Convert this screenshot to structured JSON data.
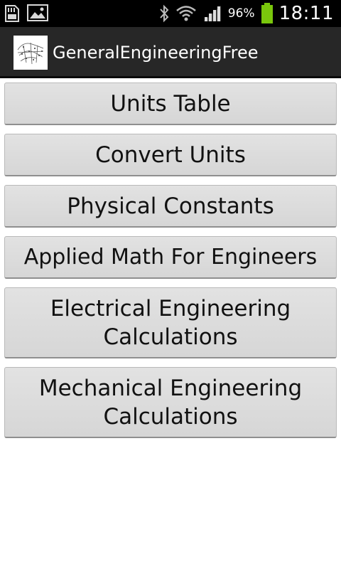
{
  "status_bar": {
    "icons_left": [
      "sd-card-icon",
      "image-icon"
    ],
    "icons_right": [
      "bluetooth-icon",
      "wifi-icon",
      "signal-icon",
      "battery-icon"
    ],
    "battery_percent": "96%",
    "time": "18:11"
  },
  "action_bar": {
    "title": "GeneralEngineeringFree",
    "icon": "app-logo-icon"
  },
  "menu": {
    "buttons": [
      {
        "label": "Units Table"
      },
      {
        "label": "Convert Units"
      },
      {
        "label": "Physical Constants"
      },
      {
        "label": "Applied Math For Engineers"
      },
      {
        "label_line1": "Electrical Engineering",
        "label_line2": "Calculations"
      },
      {
        "label_line1": "Mechanical Engineering",
        "label_line2": "Calculations"
      }
    ]
  },
  "colors": {
    "status_bar_bg": "#000000",
    "action_bar_bg": "#272727",
    "button_bg": "#dcdcdc",
    "battery_fill": "#7ac70c"
  }
}
